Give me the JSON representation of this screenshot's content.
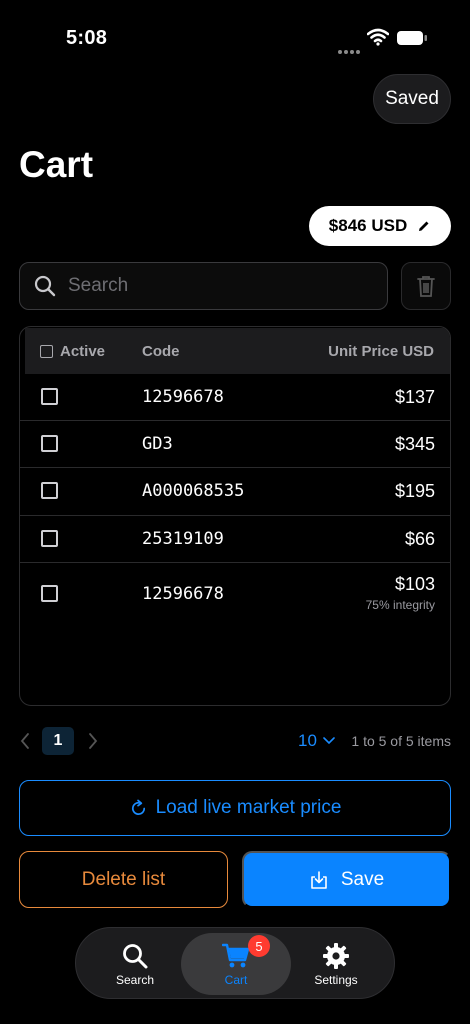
{
  "status_bar": {
    "time": "5:08"
  },
  "header": {
    "saved_label": "Saved",
    "title": "Cart"
  },
  "total": {
    "label": "$846 USD"
  },
  "search": {
    "placeholder": "Search"
  },
  "table": {
    "headers": {
      "active": "Active",
      "code": "Code",
      "price": "Unit Price USD"
    },
    "rows": [
      {
        "code": "12596678",
        "price": "$137",
        "note": ""
      },
      {
        "code": "GD3",
        "price": "$345",
        "note": ""
      },
      {
        "code": "A000068535",
        "price": "$195",
        "note": ""
      },
      {
        "code": "25319109",
        "price": "$66",
        "note": ""
      },
      {
        "code": "12596678",
        "price": "$103",
        "note": "75% integrity"
      }
    ]
  },
  "pagination": {
    "current_page": "1",
    "per_page": "10",
    "range_text": "1 to 5 of 5 items"
  },
  "actions": {
    "load_label": "Load live market price",
    "delete_label": "Delete list",
    "save_label": "Save"
  },
  "tabs": {
    "search_label": "Search",
    "cart_label": "Cart",
    "cart_badge": "5",
    "settings_label": "Settings"
  },
  "colors": {
    "accent": "#0a84ff",
    "danger": "#e88a3c",
    "badge": "#ff3b30"
  }
}
